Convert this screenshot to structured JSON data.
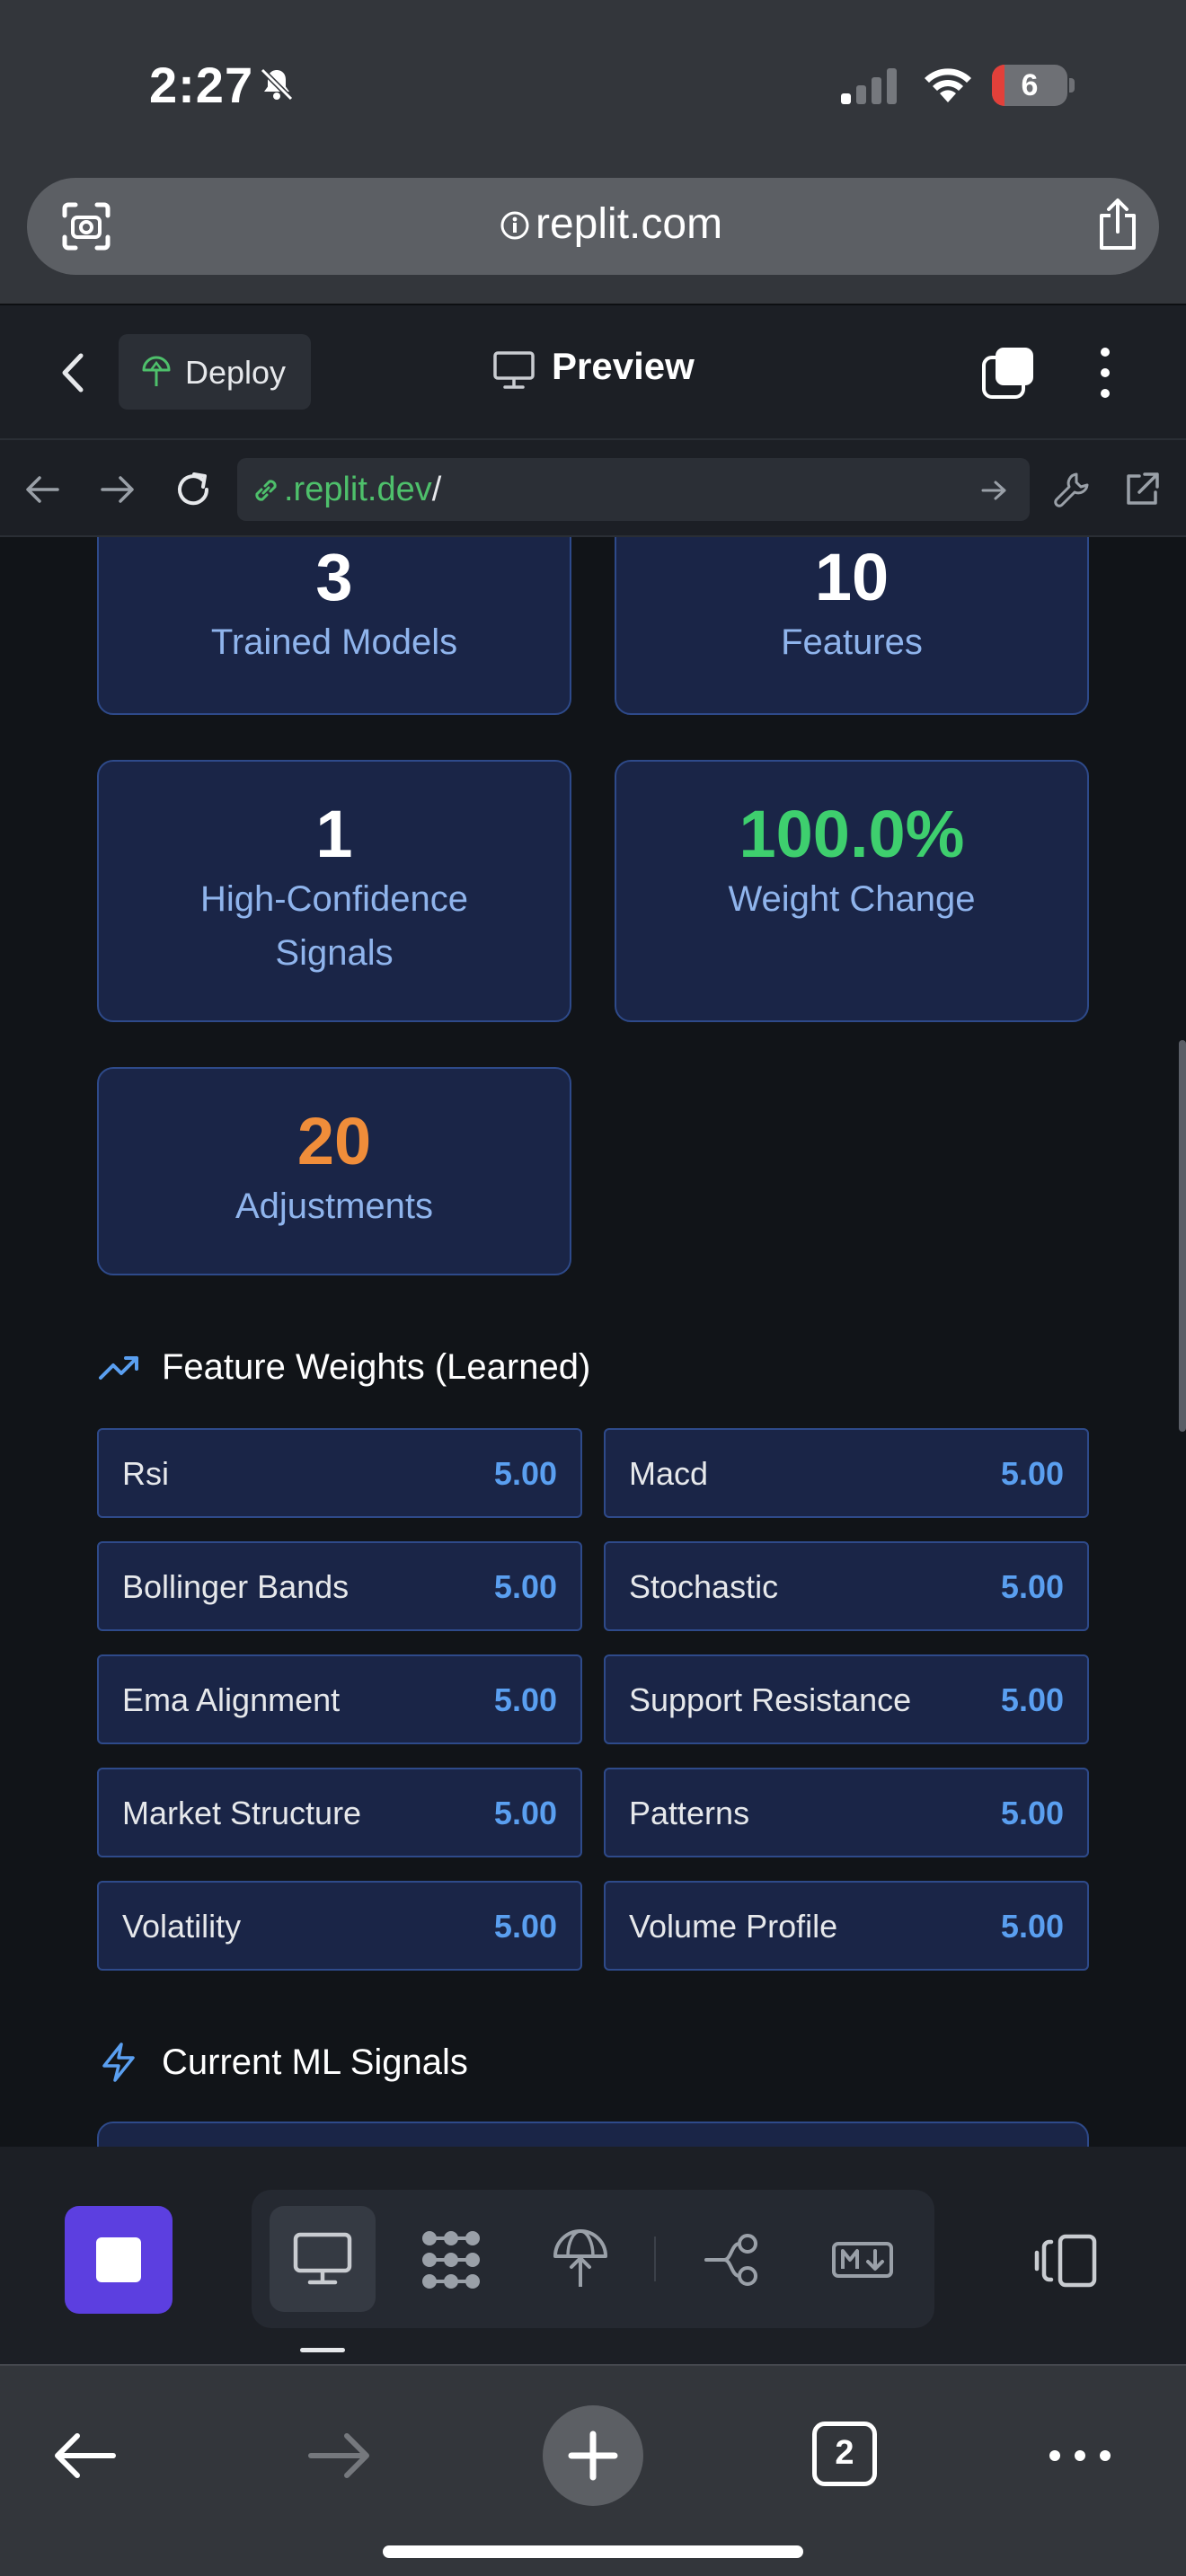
{
  "status": {
    "time": "2:27",
    "battery": "6"
  },
  "browser": {
    "domain": "replit.com"
  },
  "replit_header": {
    "deploy_label": "Deploy",
    "preview_label": "Preview"
  },
  "webview": {
    "url_green": ".replit.dev",
    "url_rest": "/"
  },
  "stats": [
    {
      "value": "3",
      "label": "Trained Models"
    },
    {
      "value": "10",
      "label": "Features"
    },
    {
      "value": "1",
      "label": "High-Confidence Signals"
    },
    {
      "value": "100.0%",
      "label": "Weight Change"
    },
    {
      "value": "20",
      "label": "Adjustments"
    }
  ],
  "feature_weights": {
    "title": "Feature Weights (Learned)",
    "items": [
      {
        "name": "Rsi",
        "value": "5.00"
      },
      {
        "name": "Macd",
        "value": "5.00"
      },
      {
        "name": "Bollinger Bands",
        "value": "5.00"
      },
      {
        "name": "Stochastic",
        "value": "5.00"
      },
      {
        "name": "Ema Alignment",
        "value": "5.00"
      },
      {
        "name": "Support Resistance",
        "value": "5.00"
      },
      {
        "name": "Market Structure",
        "value": "5.00"
      },
      {
        "name": "Patterns",
        "value": "5.00"
      },
      {
        "name": "Volatility",
        "value": "5.00"
      },
      {
        "name": "Volume Profile",
        "value": "5.00"
      }
    ]
  },
  "signals": {
    "title": "Current ML Signals"
  },
  "safari": {
    "tab_count": "2"
  },
  "colors": {
    "accent_blue": "#5a9ff0",
    "green": "#3ecf6e",
    "orange": "#f08d3a",
    "card_bg": "#1a2547",
    "run_button": "#5c3fe0"
  }
}
